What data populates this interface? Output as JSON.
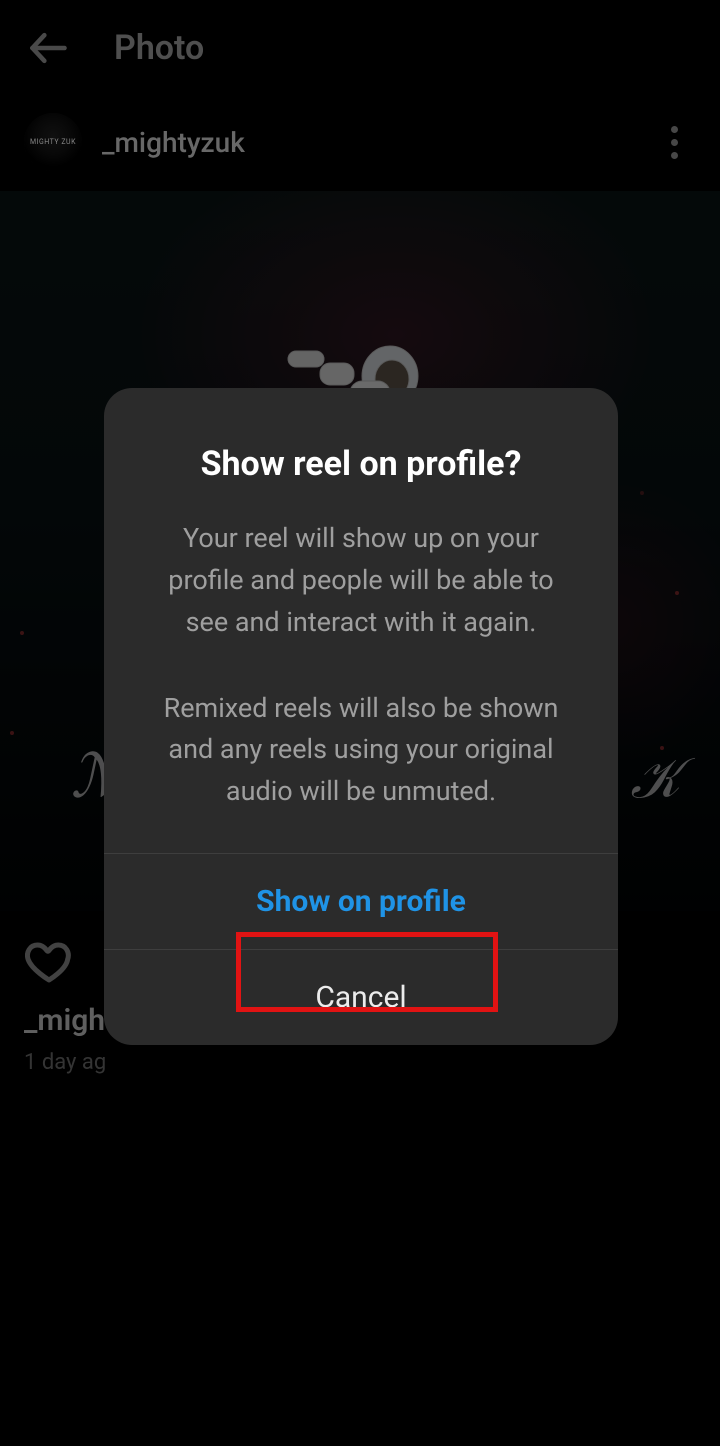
{
  "header": {
    "title": "Photo"
  },
  "post": {
    "username": "_mightyzuk",
    "caption_user_preview": "_might",
    "timestamp": "1 day ag",
    "avatar_text": "MIGHTY ZUK"
  },
  "dialog": {
    "title": "Show reel on profile?",
    "paragraph1": "Your reel will show up on your profile and people will be able to see and interact with it again.",
    "paragraph2": "Remixed reels will also be shown and any reels using your original audio will be unmuted.",
    "primary_button": "Show on profile",
    "secondary_button": "Cancel"
  },
  "colors": {
    "primary_action": "#1f93e6",
    "highlight_border": "#e11313"
  }
}
